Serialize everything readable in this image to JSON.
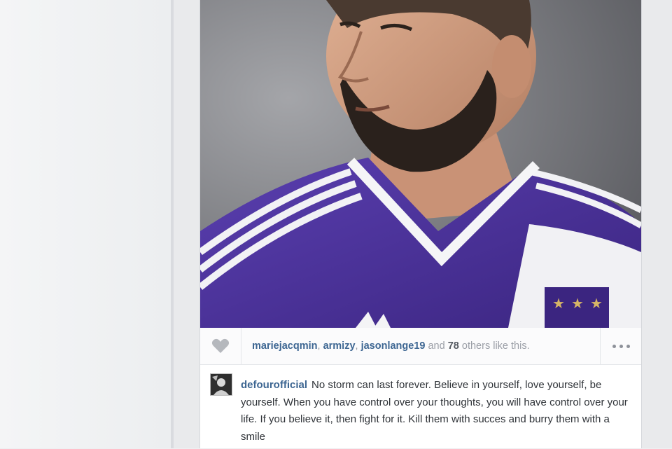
{
  "post": {
    "image_alt": "football player in purple and white kit",
    "likes": {
      "users": [
        "mariejacqmin",
        "armizy",
        "jasonlange19"
      ],
      "connector": "and",
      "others_count": "78",
      "others_suffix": "others like this."
    },
    "more_icon": "more-options-icon",
    "heart_icon": "heart-icon",
    "caption": {
      "author": "defourofficial",
      "text": "No storm can last forever. Believe in yourself,  love yourself,  be yourself. When you have control over your thoughts, you will have control over your life. If you believe it, then fight for it. Kill them with succes and burry them with a smile"
    }
  },
  "colors": {
    "link": "#3d6692",
    "kit_purple": "#4a2f96",
    "page_bg": "#eeeff1"
  }
}
